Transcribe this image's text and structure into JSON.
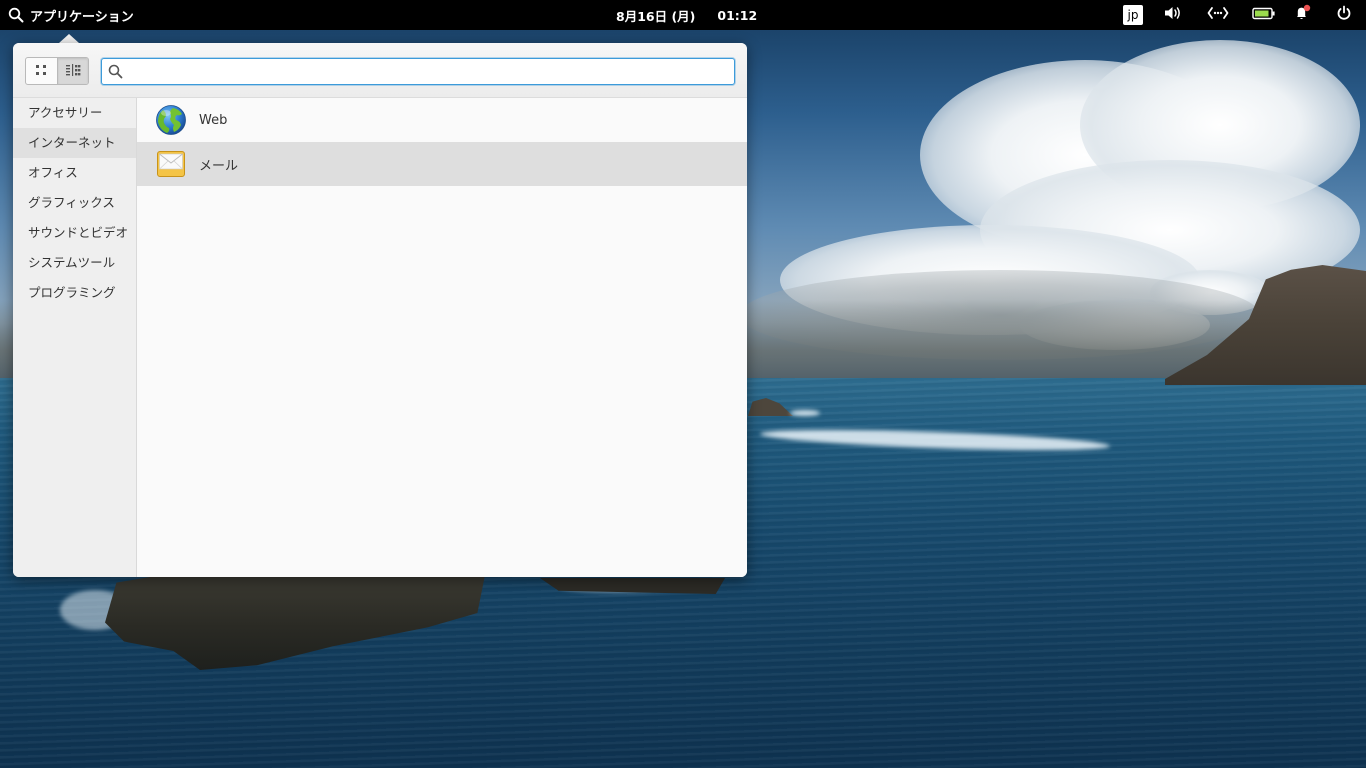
{
  "panel": {
    "apps_label": "アプリケーション",
    "date": "8月16日 (月)",
    "time": "01:12",
    "keyboard_layout": "jp",
    "icons": {
      "search": "search-icon",
      "volume": "volume-icon",
      "network": "network-wired-icon",
      "battery": "battery-icon",
      "notifications": "notification-bell-icon",
      "power": "power-icon"
    },
    "battery_level": 0.9,
    "notification_dot_color": "#ed5353"
  },
  "launcher": {
    "view_modes": [
      "grid-view",
      "category-view"
    ],
    "active_view": "category-view",
    "search": {
      "value": "",
      "placeholder": ""
    },
    "categories": [
      {
        "label": "アクセサリー",
        "selected": false
      },
      {
        "label": "インターネット",
        "selected": true
      },
      {
        "label": "オフィス",
        "selected": false
      },
      {
        "label": "グラフィックス",
        "selected": false
      },
      {
        "label": "サウンドとビデオ",
        "selected": false
      },
      {
        "label": "システムツール",
        "selected": false
      },
      {
        "label": "プログラミング",
        "selected": false
      }
    ],
    "apps": [
      {
        "label": "Web",
        "icon": "web-browser-globe-icon",
        "selected": false
      },
      {
        "label": "メール",
        "icon": "mail-envelope-icon",
        "selected": true
      }
    ]
  },
  "colors": {
    "accent": "#3d9bda",
    "panel_bg": "#000000",
    "battery_fill": "#9bdb4d"
  }
}
